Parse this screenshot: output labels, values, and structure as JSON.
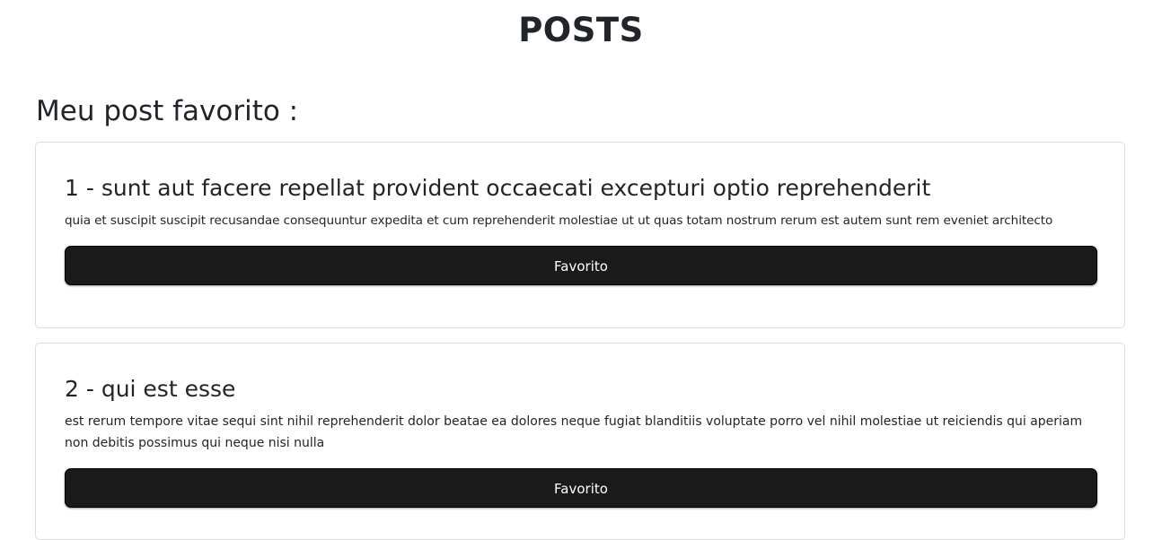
{
  "page": {
    "title": "POSTS"
  },
  "favorite_section": {
    "heading": "Meu post favorito :"
  },
  "posts": [
    {
      "title": "1 - sunt aut facere repellat provident occaecati excepturi optio reprehenderit",
      "body": "quia et suscipit suscipit recusandae consequuntur expedita et cum reprehenderit molestiae ut ut quas totam nostrum rerum est autem sunt rem eveniet architecto",
      "button_label": "Favorito"
    },
    {
      "title": "2 - qui est esse",
      "body": "est rerum tempore vitae sequi sint nihil reprehenderit dolor beatae ea dolores neque fugiat blanditiis voluptate porro vel nihil molestiae ut reiciendis qui aperiam non debitis possimus qui neque nisi nulla",
      "button_label": "Favorito"
    }
  ],
  "colors": {
    "button_background": "#1a1a1a",
    "button_text": "#ffffff",
    "card_border": "#dcdcdc",
    "text": "#212529"
  }
}
